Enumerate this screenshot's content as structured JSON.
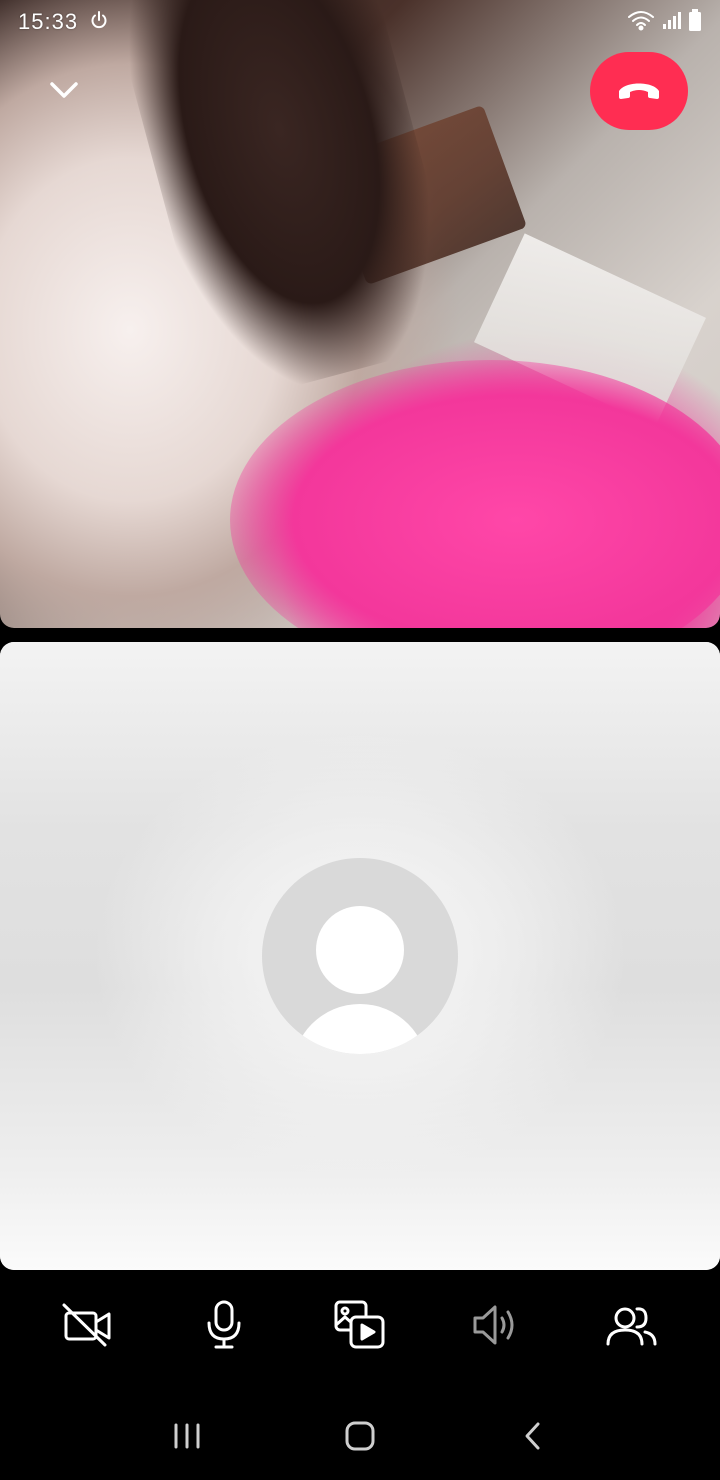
{
  "status_bar": {
    "time": "15:33",
    "icons": [
      "power-icon",
      "wifi-icon",
      "signal-icon",
      "battery-icon"
    ]
  },
  "call": {
    "collapse_icon": "chevron-down-icon",
    "end_call_icon": "hang-up-icon",
    "end_call_color": "#ff2d52",
    "self_avatar_icon": "default-avatar-icon"
  },
  "controls": [
    {
      "name": "camera-off-button",
      "icon": "camera-off-icon"
    },
    {
      "name": "microphone-button",
      "icon": "microphone-icon"
    },
    {
      "name": "share-media-button",
      "icon": "media-share-icon"
    },
    {
      "name": "speaker-button",
      "icon": "speaker-icon"
    },
    {
      "name": "participants-button",
      "icon": "people-icon"
    }
  ],
  "nav_bar": {
    "buttons": [
      "recents-icon",
      "home-icon",
      "back-icon"
    ]
  }
}
